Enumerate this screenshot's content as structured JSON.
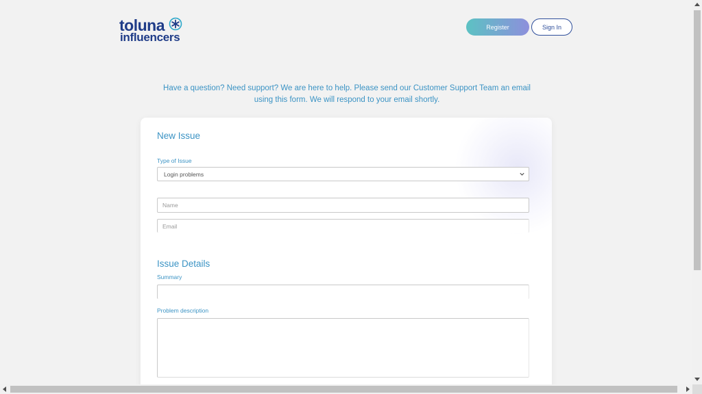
{
  "header": {
    "logo_line1": "toluna",
    "logo_line2": "influencers",
    "register_label": "Register",
    "signin_label": "Sign In"
  },
  "intro_text": "Have a question? Need support? We are here to help. Please send our Customer Support Team an email using this form. We will respond to your email shortly.",
  "form": {
    "new_issue_title": "New Issue",
    "type_label": "Type of Issue",
    "type_value": "Login problems",
    "name_placeholder": "Name",
    "email_placeholder": "Email",
    "issue_details_title": "Issue Details",
    "summary_label": "Summary",
    "description_label": "Problem description"
  },
  "colors": {
    "brand_navy": "#1f3c88",
    "accent_blue": "#3b93c4",
    "register_gradient_start": "#5cc2c3",
    "register_gradient_end": "#8d8fdc"
  },
  "icons": {
    "logo_mark": "asterisk-star-icon",
    "select_arrow": "chevron-down-icon"
  }
}
